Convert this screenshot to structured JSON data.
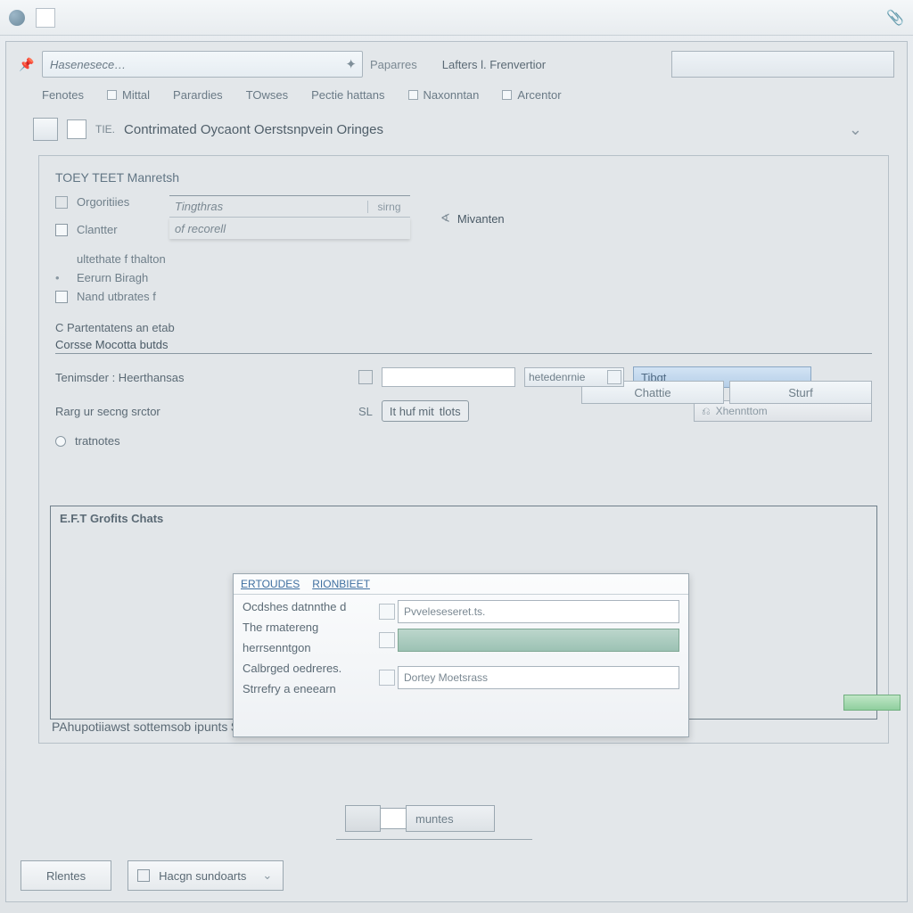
{
  "toolbar": {
    "combo_placeholder": "Hasenesece…",
    "label1": "Paparres",
    "label2": "Lafters l. Frenvertior"
  },
  "tabs": [
    "Fenotes",
    "Mittal",
    "Parardies",
    "TOwses",
    "Pectie hattans",
    "Naxonntan",
    "Arcentor"
  ],
  "doc": {
    "prefix": "TIE.",
    "title": "Contrimated Oycaont Oerstsnpvein Oringes"
  },
  "section1": {
    "title": "TOEY TEET Manretsh",
    "row1": {
      "label": "Orgoritiies",
      "f1": "Tingthras",
      "tag": "sirng",
      "f2": "of recorell"
    },
    "row2_label": "Clantter",
    "mcheck": "Mivanten",
    "r3": "ultethate f thalton",
    "r4": "Eerurn Biragh",
    "r5": "Nand utbrates f"
  },
  "mid": {
    "h1": "C Partentatens an etab",
    "h2": "Corsse Mocotta butds",
    "pill1": "Chattie",
    "pill2": "Sturf",
    "rowA": "Tenimsder : Heerthansas",
    "rowB": "Rarg ur secng srctor",
    "rowC": "tratnotes",
    "drop": "hetedenrnie",
    "blue": "Tibgt",
    "chip": "tlots",
    "chip_pre": "It huf mit",
    "gray": "Xhennttom"
  },
  "subpanel": {
    "header": "E.F.T Grofits Chats"
  },
  "popup": {
    "tabs": [
      "ERTOUDES",
      "RIONBIEET"
    ],
    "labels": [
      "Ocdshes datnnthe d",
      "The rmatereng",
      "herrsenntgon",
      "Calbrged oedreres.",
      "Strrefry a eneearn"
    ],
    "field1": "Pvveleseseret.ts.",
    "field3": "Dortey Moetsrass"
  },
  "footer_text": "PAhupotiiawst sottemsob ipunts",
  "centerbtn": "muntes",
  "bottom": {
    "b1": "Rlentes",
    "b2": "Hacgn sundoarts"
  }
}
